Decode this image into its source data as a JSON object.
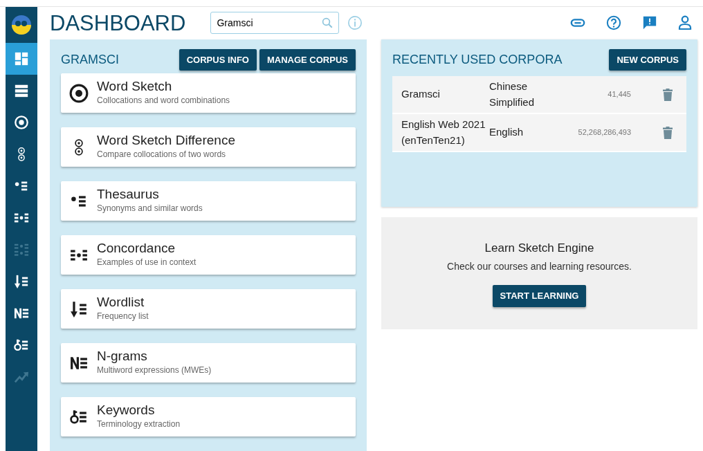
{
  "header": {
    "title": "DASHBOARD",
    "search": {
      "value": "Gramsci"
    }
  },
  "sidebar": {
    "items": [
      {
        "kind": "dashboard",
        "selected": true,
        "disabled": false
      },
      {
        "kind": "corpora",
        "selected": false,
        "disabled": false
      },
      {
        "kind": "wordsketch",
        "selected": false,
        "disabled": false
      },
      {
        "kind": "wsdiff",
        "selected": false,
        "disabled": false
      },
      {
        "kind": "thesaurus",
        "selected": false,
        "disabled": false
      },
      {
        "kind": "concordance",
        "selected": false,
        "disabled": false
      },
      {
        "kind": "parconc",
        "selected": false,
        "disabled": true
      },
      {
        "kind": "wordlist",
        "selected": false,
        "disabled": false
      },
      {
        "kind": "ngrams",
        "selected": false,
        "disabled": false
      },
      {
        "kind": "keywords",
        "selected": false,
        "disabled": false
      },
      {
        "kind": "trends",
        "selected": false,
        "disabled": true
      }
    ]
  },
  "corpus_panel": {
    "title": "GRAMSCI",
    "buttons": [
      "CORPUS INFO",
      "MANAGE CORPUS"
    ],
    "tools": [
      {
        "kind": "wordsketch",
        "title": "Word Sketch",
        "description": "Collocations and word combinations"
      },
      {
        "kind": "wsdiff",
        "title": "Word Sketch Difference",
        "description": "Compare collocations of two words"
      },
      {
        "kind": "thesaurus",
        "title": "Thesaurus",
        "description": "Synonyms and similar words"
      },
      {
        "kind": "concordance",
        "title": "Concordance",
        "description": "Examples of use in context"
      },
      {
        "kind": "wordlist",
        "title": "Wordlist",
        "description": "Frequency list"
      },
      {
        "kind": "ngrams",
        "title": "N-grams",
        "description": "Multiword expressions (MWEs)"
      },
      {
        "kind": "keywords",
        "title": "Keywords",
        "description": "Terminology extraction"
      }
    ]
  },
  "recent_panel": {
    "title": "RECENTLY USED CORPORA",
    "button": "NEW CORPUS",
    "rows": [
      {
        "name": "Gramsci",
        "language": "Chinese Simplified",
        "size": "41,445"
      },
      {
        "name": "English Web 2021 (enTenTen21)",
        "language": "English",
        "size": "52,268,286,493"
      }
    ]
  },
  "learn_panel": {
    "title": "Learn Sketch Engine",
    "text": "Check our courses and learning resources.",
    "button": "START LEARNING"
  }
}
